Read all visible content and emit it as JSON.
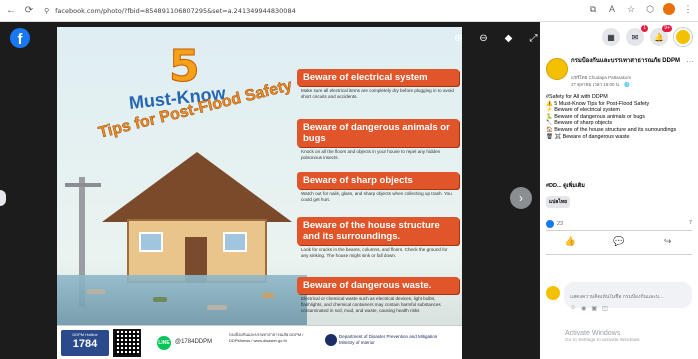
{
  "browser": {
    "url": "facebook.com/photo/?fbid=854891106807295&set=a.241349944830084",
    "nav_back": "←",
    "nav_reload": "⟳",
    "lock_icon": "⚲"
  },
  "viewer": {
    "fb_logo": "f",
    "next_arrow": "›"
  },
  "poster": {
    "number": "5",
    "title_line1": "Must-Know",
    "title_line2": "Tips for Post-Flood Safety",
    "sections": [
      {
        "title": "Beware of electrical system",
        "body": "Make sure all electrical items are completely dry before plugging in to avoid short circuits and accidents."
      },
      {
        "title": "Beware of dangerous animals or bugs",
        "body": "Knock on all the floors and objects in your house to repel any hidden poisonous insects."
      },
      {
        "title": "Beware of sharp objects",
        "body": "Watch out for nails, glass, and sharp objects when collecting up trash. You could get hurt."
      },
      {
        "title": "Beware of the house structure and its surroundings.",
        "body": "Look for cracks in the beams, columns, and floors. Check the ground for any sinking. The house might sink or fall down."
      },
      {
        "title": "Beware of dangerous waste.",
        "body": "Electrical or chemical waste such as electrical devices, light bulbs, flashlights, and chemical containers may contain harmful substances contaminated in soil, mud, and waste, causing health risks"
      }
    ],
    "hotline_label": "DDPM Hotline",
    "hotline_number": "1784",
    "line_label": "LINE",
    "line_id": "@1784DDPM",
    "footer_links": "กองป้องกันและบรรเทาสาธารณภัย DDPM / DDPMnews / www.disaster.go.th",
    "dept_name": "Department of Disaster Prevention and Mitigation Ministry of Interior"
  },
  "panel": {
    "page_name": "กรมป้องกันและบรรเทาสาธารณภัย DDPM",
    "page_sub": "แชร์โดย Chudapa Pattarakom",
    "page_time": "27 ตุลาคม เวลา 18:00 น. · 🌐",
    "post_lines": [
      "#Safety for All with DDPM",
      "⚠️ 5 Must-Know Tips for Post-Flood Safety",
      "⚡ Beware of electrical system",
      "🐍 Beware of dangerous animals or bugs",
      "🔪 Beware of sharp objects",
      "🏠 Beware of the house structure and its surroundings",
      "🗑 ☠ Beware of dangerous waste"
    ],
    "hashtag": "#DD... ดูเพิ่มเติม",
    "translate_label": "แปลไทย",
    "reaction_count": "23",
    "share_count": "7",
    "comment_placeholder": "แสดงความคิดเห็นในชื่อ กรมป้องกันและบ...",
    "notif_badge": "9+",
    "message_badge": "1"
  },
  "watermark": {
    "title": "Activate Windows",
    "sub": "Go to Settings to activate Windows."
  }
}
